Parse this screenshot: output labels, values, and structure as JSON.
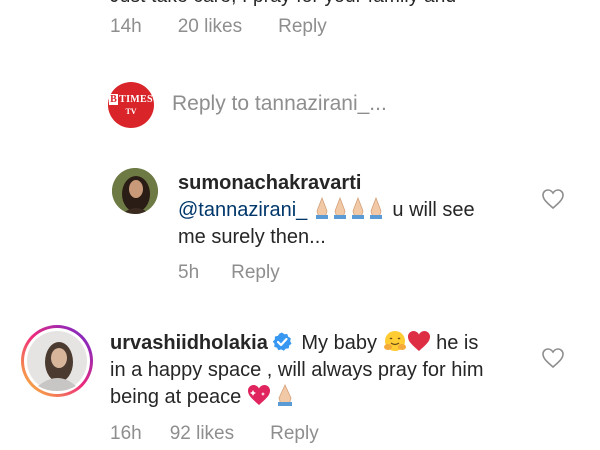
{
  "top_comment": {
    "partial_text": "Just take care, I pray for your family and",
    "time": "14h",
    "likes": "20 likes",
    "reply_label": "Reply"
  },
  "reply_bar": {
    "avatar_logo_top": "TIMES",
    "avatar_logo_bottom": "TV",
    "placeholder": "Reply to tannazirani_..."
  },
  "reply_comment": {
    "username": "sumonachakravarti",
    "mention": "@tannazirani_",
    "text_after_emoji": " u will see",
    "line2": "me surely then...",
    "time": "5h",
    "reply_label": "Reply"
  },
  "main_comment": {
    "username": "urvashiidholakia",
    "text_start": " My baby ",
    "text_after_heart": " he is",
    "line2": "in a happy space , will always pray for him",
    "line3": "being at peace ",
    "time": "16h",
    "likes": "92 likes",
    "reply_label": "Reply"
  },
  "colors": {
    "text": "#262626",
    "muted": "#8e8e8e",
    "mention": "#00376b",
    "verified": "#3897f0",
    "times_red": "#d9252a"
  }
}
